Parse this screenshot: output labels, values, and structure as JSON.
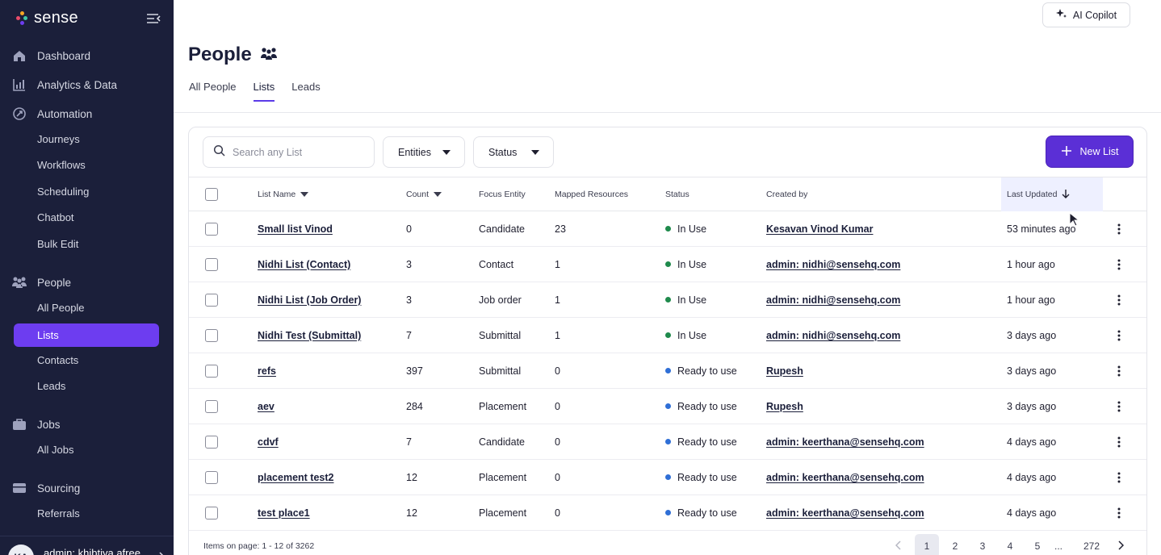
{
  "brand": {
    "name": "sense",
    "dot_colors": [
      "#f5a623",
      "#e94b6a",
      "#3ec7a8",
      "#6d3df0",
      "#ff7b3a"
    ]
  },
  "sidebar": {
    "sections": [
      {
        "label": "Dashboard",
        "icon": "home-icon"
      },
      {
        "label": "Analytics & Data",
        "icon": "chart-icon"
      },
      {
        "label": "Automation",
        "icon": "automation-icon"
      },
      {
        "label": "People",
        "icon": "people-icon"
      },
      {
        "label": "Jobs",
        "icon": "briefcase-icon"
      },
      {
        "label": "Sourcing",
        "icon": "sourcing-icon"
      }
    ],
    "automation_items": [
      "Journeys",
      "Workflows",
      "Scheduling",
      "Chatbot",
      "Bulk Edit"
    ],
    "people_items": [
      "All People",
      "Lists",
      "Contacts",
      "Leads"
    ],
    "jobs_items": [
      "All Jobs"
    ],
    "sourcing_items": [
      "Referrals"
    ],
    "user": {
      "initials": "KA",
      "name": "admin: khibtiya.afree"
    }
  },
  "header": {
    "copilot_label": "AI Copilot"
  },
  "page": {
    "title": "People",
    "tabs": [
      {
        "label": "All People",
        "active": false
      },
      {
        "label": "Lists",
        "active": true
      },
      {
        "label": "Leads",
        "active": false
      }
    ]
  },
  "toolbar": {
    "search_placeholder": "Search any List",
    "entities_label": "Entities",
    "status_label": "Status",
    "new_list_label": "New List"
  },
  "table": {
    "columns": {
      "name": "List Name",
      "count": "Count",
      "entity": "Focus Entity",
      "mapped": "Mapped Resources",
      "status": "Status",
      "created_by": "Created by",
      "updated": "Last Updated"
    },
    "rows": [
      {
        "name": "Small list Vinod",
        "count": "0",
        "entity": "Candidate",
        "mapped": "23",
        "status": "In Use",
        "status_color": "#1f8a4c",
        "created_by": "Kesavan Vinod Kumar",
        "updated": "53 minutes ago"
      },
      {
        "name": "Nidhi List (Contact)",
        "count": "3",
        "entity": "Contact",
        "mapped": "1",
        "status": "In Use",
        "status_color": "#1f8a4c",
        "created_by": "admin: nidhi@sensehq.com",
        "updated": "1 hour ago"
      },
      {
        "name": "Nidhi List (Job Order)",
        "count": "3",
        "entity": "Job order",
        "mapped": "1",
        "status": "In Use",
        "status_color": "#1f8a4c",
        "created_by": "admin: nidhi@sensehq.com",
        "updated": "1 hour ago"
      },
      {
        "name": "Nidhi Test (Submittal)",
        "count": "7",
        "entity": "Submittal",
        "mapped": "1",
        "status": "In Use",
        "status_color": "#1f8a4c",
        "created_by": "admin: nidhi@sensehq.com",
        "updated": "3 days ago"
      },
      {
        "name": "refs",
        "count": "397",
        "entity": "Submittal",
        "mapped": "0",
        "status": "Ready to use",
        "status_color": "#2f6fd6",
        "created_by": "Rupesh",
        "updated": "3 days ago"
      },
      {
        "name": "aev",
        "count": "284",
        "entity": "Placement",
        "mapped": "0",
        "status": "Ready to use",
        "status_color": "#2f6fd6",
        "created_by": "Rupesh",
        "updated": "3 days ago"
      },
      {
        "name": "cdvf",
        "count": "7",
        "entity": "Candidate",
        "mapped": "0",
        "status": "Ready to use",
        "status_color": "#2f6fd6",
        "created_by": "admin: keerthana@sensehq.com",
        "updated": "4 days ago"
      },
      {
        "name": "placement test2",
        "count": "12",
        "entity": "Placement",
        "mapped": "0",
        "status": "Ready to use",
        "status_color": "#2f6fd6",
        "created_by": "admin: keerthana@sensehq.com",
        "updated": "4 days ago"
      },
      {
        "name": "test place1",
        "count": "12",
        "entity": "Placement",
        "mapped": "0",
        "status": "Ready to use",
        "status_color": "#2f6fd6",
        "created_by": "admin: keerthana@sensehq.com",
        "updated": "4 days ago"
      }
    ]
  },
  "pagination": {
    "summary": "Items on page: 1 - 12 of 3262",
    "pages": [
      "1",
      "2",
      "3",
      "4",
      "5",
      "...",
      "272"
    ],
    "current": "1"
  }
}
